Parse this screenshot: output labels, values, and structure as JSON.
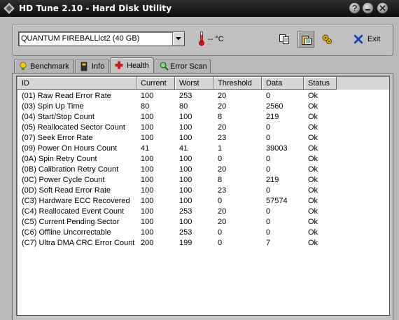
{
  "window": {
    "title": "HD Tune 2.10 - Hard Disk Utility"
  },
  "toolbar": {
    "drive": "QUANTUM FIREBALLlct2 (40 GB)",
    "temperature": "-- °C",
    "exit_label": "Exit"
  },
  "tabs": [
    {
      "label": "Benchmark",
      "icon": "bulb-icon"
    },
    {
      "label": "Info",
      "icon": "info-icon"
    },
    {
      "label": "Health",
      "icon": "health-cross-icon",
      "active": true
    },
    {
      "label": "Error Scan",
      "icon": "magnifier-icon"
    }
  ],
  "table": {
    "columns": [
      "ID",
      "Current",
      "Worst",
      "Threshold",
      "Data",
      "Status"
    ],
    "rows": [
      [
        "(01) Raw Read Error Rate",
        "100",
        "253",
        "20",
        "0",
        "Ok"
      ],
      [
        "(03) Spin Up Time",
        "80",
        "80",
        "20",
        "2560",
        "Ok"
      ],
      [
        "(04) Start/Stop Count",
        "100",
        "100",
        "8",
        "219",
        "Ok"
      ],
      [
        "(05) Reallocated Sector Count",
        "100",
        "100",
        "20",
        "0",
        "Ok"
      ],
      [
        "(07) Seek Error Rate",
        "100",
        "100",
        "23",
        "0",
        "Ok"
      ],
      [
        "(09) Power On Hours Count",
        "41",
        "41",
        "1",
        "39003",
        "Ok"
      ],
      [
        "(0A) Spin Retry Count",
        "100",
        "100",
        "0",
        "0",
        "Ok"
      ],
      [
        "(0B) Calibration Retry Count",
        "100",
        "100",
        "20",
        "0",
        "Ok"
      ],
      [
        "(0C) Power Cycle Count",
        "100",
        "100",
        "8",
        "219",
        "Ok"
      ],
      [
        "(0D) Soft Read Error Rate",
        "100",
        "100",
        "23",
        "0",
        "Ok"
      ],
      [
        "(C3) Hardware ECC Recovered",
        "100",
        "100",
        "0",
        "57574",
        "Ok"
      ],
      [
        "(C4) Reallocated Event Count",
        "100",
        "253",
        "20",
        "0",
        "Ok"
      ],
      [
        "(C5) Current Pending Sector",
        "100",
        "100",
        "20",
        "0",
        "Ok"
      ],
      [
        "(C6) Offline Uncorrectable",
        "100",
        "253",
        "0",
        "0",
        "Ok"
      ],
      [
        "(C7) Ultra DMA CRC Error Count",
        "200",
        "199",
        "0",
        "7",
        "Ok"
      ]
    ]
  },
  "colors": {
    "titlebar": "#1a1a1a",
    "window": "#b9b9b9",
    "list_bg": "#ffffff",
    "health_icon": "#d21a1a"
  }
}
